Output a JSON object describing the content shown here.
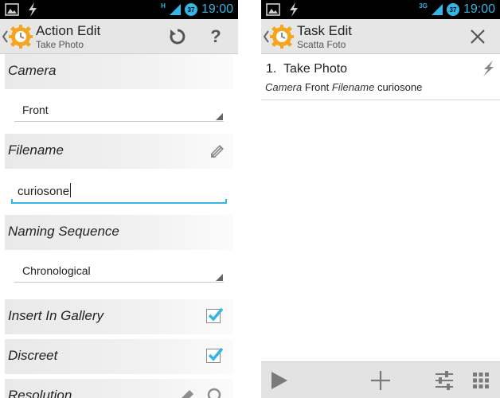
{
  "colors": {
    "accent": "#33b5e5",
    "statusbar_bg": "#000000",
    "actionbar_bg": "#e6e6e6",
    "header_bg": "#eeeeee",
    "bottombar_bg": "#e3e3e3"
  },
  "left": {
    "status": {
      "network": "H",
      "battery": "37",
      "time": "19:00"
    },
    "actionbar": {
      "title": "Action Edit",
      "subtitle": "Take Photo",
      "icons": [
        "back-icon",
        "tasker-logo-icon",
        "undo-icon",
        "help-icon"
      ],
      "help_label": "?"
    },
    "fields": {
      "camera": {
        "label": "Camera",
        "value": "Front"
      },
      "filename": {
        "label": "Filename",
        "value": "curiosone"
      },
      "naming": {
        "label": "Naming Sequence",
        "value": "Chronological"
      },
      "gallery": {
        "label": "Insert In Gallery",
        "checked": true
      },
      "discreet": {
        "label": "Discreet",
        "checked": true
      },
      "resolution": {
        "label": "Resolution"
      }
    }
  },
  "right": {
    "status": {
      "network": "3G",
      "battery": "37",
      "time": "19:00"
    },
    "actionbar": {
      "title": "Task Edit",
      "subtitle": "Scatta Foto",
      "icons": [
        "back-icon",
        "tasker-logo-icon",
        "close-icon"
      ]
    },
    "task": {
      "number": "1.",
      "name": "Take Photo",
      "param1_label": "Camera",
      "param1_value": "Front",
      "param2_label": "Filename",
      "param2_value": "curiosone"
    },
    "bottombar": {
      "icons": [
        "play-icon",
        "add-icon",
        "sliders-icon",
        "grid-icon"
      ]
    }
  }
}
